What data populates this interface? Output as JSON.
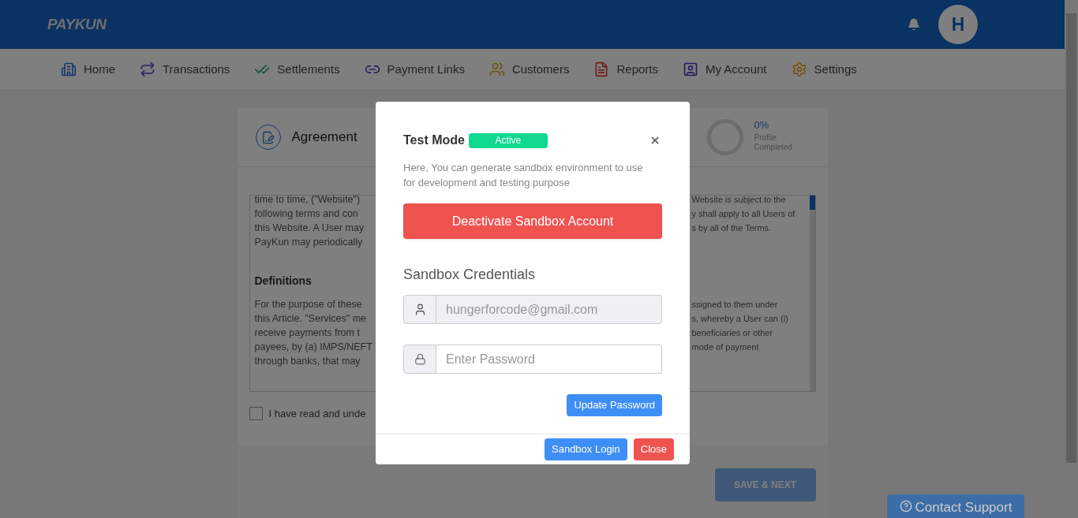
{
  "header": {
    "logo": "PAYKUN",
    "avatar": "H"
  },
  "nav": [
    {
      "label": "Home"
    },
    {
      "label": "Transactions"
    },
    {
      "label": "Settlements"
    },
    {
      "label": "Payment Links"
    },
    {
      "label": "Customers"
    },
    {
      "label": "Reports"
    },
    {
      "label": "My Account"
    },
    {
      "label": "Settings"
    }
  ],
  "card": {
    "title": "Agreement",
    "progress": {
      "percent": "0%",
      "label_1": "Profile",
      "label_2": "Completed"
    },
    "paragraph_1": [
      {
        "left": "time to time, (\"Website\")",
        "right": "Website is subject to the"
      },
      {
        "left": "following terms and con",
        "right": "y shall apply to all Users of"
      },
      {
        "left": "this Website. A User may",
        "right": "s by all of the Terms."
      },
      {
        "left": "PayKun may periodically"
      }
    ],
    "heading": "Definitions",
    "paragraph_2": [
      {
        "left": "For the purpose of these",
        "right": "ssigned to them under"
      },
      {
        "left": "this Article. \"Services\" me",
        "right": "s, whereby a User can (i)"
      },
      {
        "left": "receive payments from t",
        "right": "beneficiaries or other"
      },
      {
        "left": "payees, by (a) IMPS/NEFT",
        "right": "mode of payment"
      },
      {
        "left": "through banks, that may"
      }
    ],
    "agree": {
      "label": "I have read and unde",
      "checked": false
    },
    "save_button": "SAVE & NEXT"
  },
  "contact_support": "Contact Support",
  "modal": {
    "title": "Test Mode",
    "badge": "Active",
    "description": "Here, You can generate sandbox environment to use for development and testing purpose",
    "deactivate_button": "Deactivate Sandbox Account",
    "section_title": "Sandbox Credentials",
    "email": {
      "value": "hungerforcode@gmail.com",
      "disabled": true
    },
    "password": {
      "placeholder": "Enter Password"
    },
    "update_button": "Update Password",
    "login_button": "Sandbox Login",
    "close_button": "Close"
  }
}
